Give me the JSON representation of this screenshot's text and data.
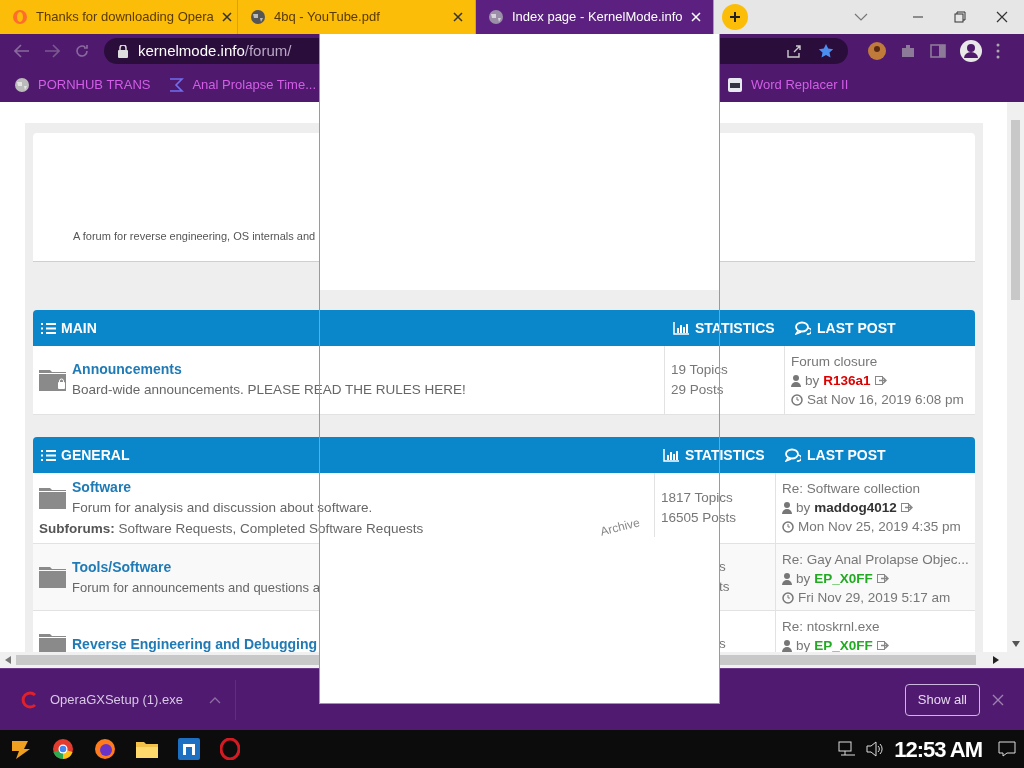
{
  "tabs": [
    {
      "title": "Thanks for downloading Opera",
      "selected": false
    },
    {
      "title": "4bq - YouTube.pdf",
      "selected": false
    },
    {
      "title": "Index page - KernelMode.info",
      "selected": true
    }
  ],
  "address": {
    "domain": "kernelmode.info",
    "path": "/forum/"
  },
  "bookmarks": [
    "PORNHUB TRANS",
    "Anal Prolapse Time...",
    "Word Replacer II"
  ],
  "site": {
    "tagline": "A forum for reverse engineering, OS internals and"
  },
  "sections": [
    {
      "title": "MAIN",
      "stats_label": "STATISTICS",
      "last_label": "LAST POST",
      "forums": [
        {
          "name": "Announcements",
          "description": "Board-wide announcements. PLEASE READ THE RULES HERE!",
          "locked": true,
          "topics": "19 Topics",
          "posts": "29 Posts",
          "last_post": {
            "title": "Forum closure",
            "by": "by",
            "author": "R136a1",
            "color": "#dd0000",
            "date": "Sat Nov 16, 2019 6:08 pm"
          }
        }
      ]
    },
    {
      "title": "GENERAL",
      "stats_label": "STATISTICS",
      "last_label": "LAST POST",
      "forums": [
        {
          "name": "Software",
          "description": "Forum for analysis and discussion about software.",
          "subforums": "**Subforums:** Software Requests, Completed Software Requests",
          "locked": false,
          "topics": "1817 Topics",
          "posts": "16505 Posts",
          "last_post": {
            "title": "Re: Software collection",
            "by": "by",
            "author": "maddog4012",
            "color": "#333333",
            "date": "Mon Nov 25, 2019 4:35 pm"
          }
        },
        {
          "name": "Tools/Software",
          "description": "Forum for announcements and questions a",
          "locked": false,
          "topics": "s",
          "posts": "ts",
          "last_post": {
            "title": "Re: Gay Anal Prolapse Objec...",
            "by": "by",
            "author": "EP_X0FF",
            "color": "#22aa22",
            "date": "Fri Nov 29, 2019 5:17 am"
          }
        },
        {
          "name": "Reverse Engineering and Debugging",
          "locked": false,
          "topics": "s",
          "last_post": {
            "title": "Re: ntoskrnl.exe",
            "by": "by",
            "author": "EP_X0FF",
            "color": "#22aa22"
          }
        }
      ]
    }
  ],
  "stray_text": "Archive",
  "download": {
    "file": "OperaGXSetup (1).exe",
    "button": "Show all"
  },
  "taskbar": {
    "time": "12:53 AM"
  }
}
